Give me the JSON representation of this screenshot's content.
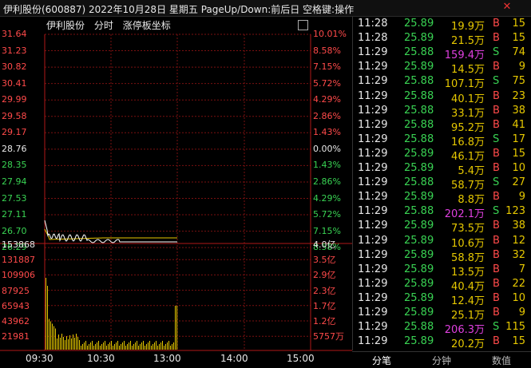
{
  "window": {
    "title": "伊利股份(600887)  2022年10月28日  星期五  PageUp/Down:前后日  空格键:操作",
    "close_glyph": "✕"
  },
  "chart": {
    "stock_name": "伊利股份",
    "mode_label": "分时",
    "axis_label": "涨停板坐标",
    "price_labels": [
      "31.64",
      "31.23",
      "30.82",
      "30.41",
      "29.99",
      "29.58",
      "29.17",
      "28.76",
      "28.35",
      "27.94",
      "27.53",
      "27.11",
      "26.70",
      "26.29"
    ],
    "pct_labels": [
      "10.01%",
      "8.58%",
      "7.15%",
      "5.72%",
      "4.29%",
      "2.86%",
      "1.43%",
      "0.00%",
      "1.43%",
      "2.86%",
      "4.29%",
      "5.72%",
      "7.15%",
      "8.58%"
    ],
    "volume_labels": [
      "153868",
      "131887",
      "109906",
      "87925",
      "65943",
      "43962",
      "21981"
    ],
    "amount_labels": [
      "4.0亿",
      "3.5亿",
      "2.9亿",
      "2.3亿",
      "1.7亿",
      "1.2亿",
      "5757万"
    ],
    "time_labels": [
      "09:30",
      "10:30",
      "13:00",
      "14:00",
      "15:00"
    ],
    "colors": {
      "up": "#ff4a4a",
      "down": "#39d353",
      "neutral": "#e8e8e8",
      "grid": "#7a1010",
      "volume": "#e6c800"
    }
  },
  "trades": [
    {
      "time": "11:28",
      "price": "25.89",
      "vol": "19.9万",
      "bs": "B",
      "n": "15",
      "vc": "y"
    },
    {
      "time": "11:28",
      "price": "25.89",
      "vol": "21.5万",
      "bs": "B",
      "n": "15",
      "vc": "y"
    },
    {
      "time": "11:29",
      "price": "25.88",
      "vol": "159.4万",
      "bs": "S",
      "n": "74",
      "vc": "m"
    },
    {
      "time": "11:29",
      "price": "25.89",
      "vol": "14.5万",
      "bs": "B",
      "n": "9",
      "vc": "y"
    },
    {
      "time": "11:29",
      "price": "25.88",
      "vol": "107.1万",
      "bs": "S",
      "n": "75",
      "vc": "y"
    },
    {
      "time": "11:29",
      "price": "25.88",
      "vol": "40.1万",
      "bs": "B",
      "n": "23",
      "vc": "y"
    },
    {
      "time": "11:29",
      "price": "25.88",
      "vol": "33.1万",
      "bs": "B",
      "n": "38",
      "vc": "y"
    },
    {
      "time": "11:29",
      "price": "25.88",
      "vol": "95.2万",
      "bs": "B",
      "n": "41",
      "vc": "y"
    },
    {
      "time": "11:29",
      "price": "25.88",
      "vol": "16.8万",
      "bs": "S",
      "n": "17",
      "vc": "y"
    },
    {
      "time": "11:29",
      "price": "25.89",
      "vol": "46.1万",
      "bs": "B",
      "n": "15",
      "vc": "y"
    },
    {
      "time": "11:29",
      "price": "25.89",
      "vol": "5.4万",
      "bs": "B",
      "n": "10",
      "vc": "y"
    },
    {
      "time": "11:29",
      "price": "25.88",
      "vol": "58.7万",
      "bs": "S",
      "n": "27",
      "vc": "y"
    },
    {
      "time": "11:29",
      "price": "25.89",
      "vol": "8.8万",
      "bs": "B",
      "n": "9",
      "vc": "y"
    },
    {
      "time": "11:29",
      "price": "25.88",
      "vol": "202.1万",
      "bs": "S",
      "n": "123",
      "vc": "m"
    },
    {
      "time": "11:29",
      "price": "25.89",
      "vol": "73.5万",
      "bs": "B",
      "n": "38",
      "vc": "y"
    },
    {
      "time": "11:29",
      "price": "25.89",
      "vol": "10.6万",
      "bs": "B",
      "n": "12",
      "vc": "y"
    },
    {
      "time": "11:29",
      "price": "25.89",
      "vol": "58.8万",
      "bs": "B",
      "n": "32",
      "vc": "y"
    },
    {
      "time": "11:29",
      "price": "25.89",
      "vol": "13.5万",
      "bs": "B",
      "n": "7",
      "vc": "y"
    },
    {
      "time": "11:29",
      "price": "25.89",
      "vol": "40.4万",
      "bs": "B",
      "n": "22",
      "vc": "y"
    },
    {
      "time": "11:29",
      "price": "25.89",
      "vol": "12.4万",
      "bs": "B",
      "n": "10",
      "vc": "y"
    },
    {
      "time": "11:29",
      "price": "25.89",
      "vol": "25.1万",
      "bs": "B",
      "n": "9",
      "vc": "y"
    },
    {
      "time": "11:29",
      "price": "25.88",
      "vol": "206.3万",
      "bs": "S",
      "n": "115",
      "vc": "m"
    },
    {
      "time": "11:29",
      "price": "25.89",
      "vol": "20.2万",
      "bs": "B",
      "n": "15",
      "vc": "y"
    }
  ],
  "tabs": [
    "分笔",
    "分钟",
    "数值"
  ]
}
